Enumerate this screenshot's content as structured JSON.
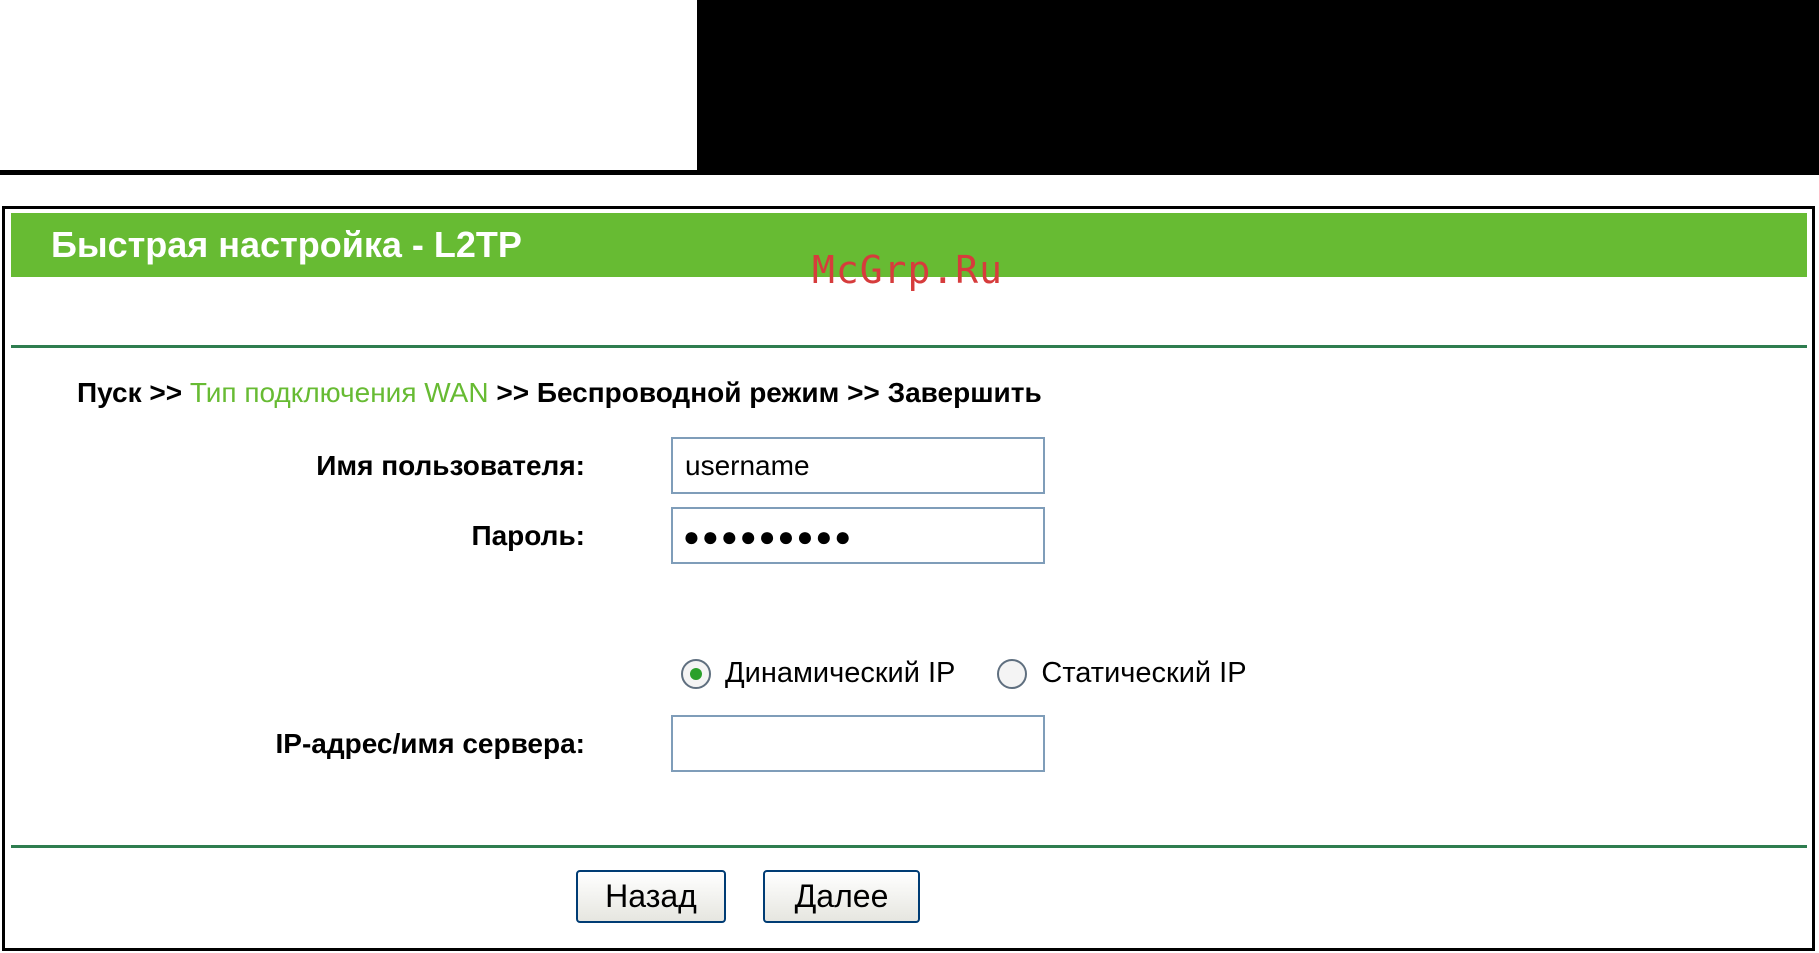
{
  "panel": {
    "title": "Быстрая настройка - L2TP"
  },
  "breadcrumb": {
    "start": "Пуск",
    "sep1": ">>",
    "current": "Тип подключения WAN",
    "sep2": ">>",
    "wireless": "Беспроводной режим",
    "sep3": ">>",
    "finish": "Завершить"
  },
  "form": {
    "username_label": "Имя пользователя:",
    "username_value": "username",
    "password_label": "Пароль:",
    "password_masked": "●●●●●●●●●",
    "ip_mode": {
      "selected": "dynamic",
      "options": [
        {
          "label": "Динамический IP"
        },
        {
          "label": "Статический IP"
        }
      ]
    },
    "server_label": "IP-адрес/имя сервера:",
    "server_value": ""
  },
  "buttons": {
    "back_label": "Назад",
    "next_label": "Далее"
  },
  "watermark": "McGrp.Ru",
  "colors": {
    "header_green": "#67bb33",
    "link_green": "#67bb33",
    "divider": "#2e7d4f",
    "watermark_red": "#d63c3c"
  }
}
